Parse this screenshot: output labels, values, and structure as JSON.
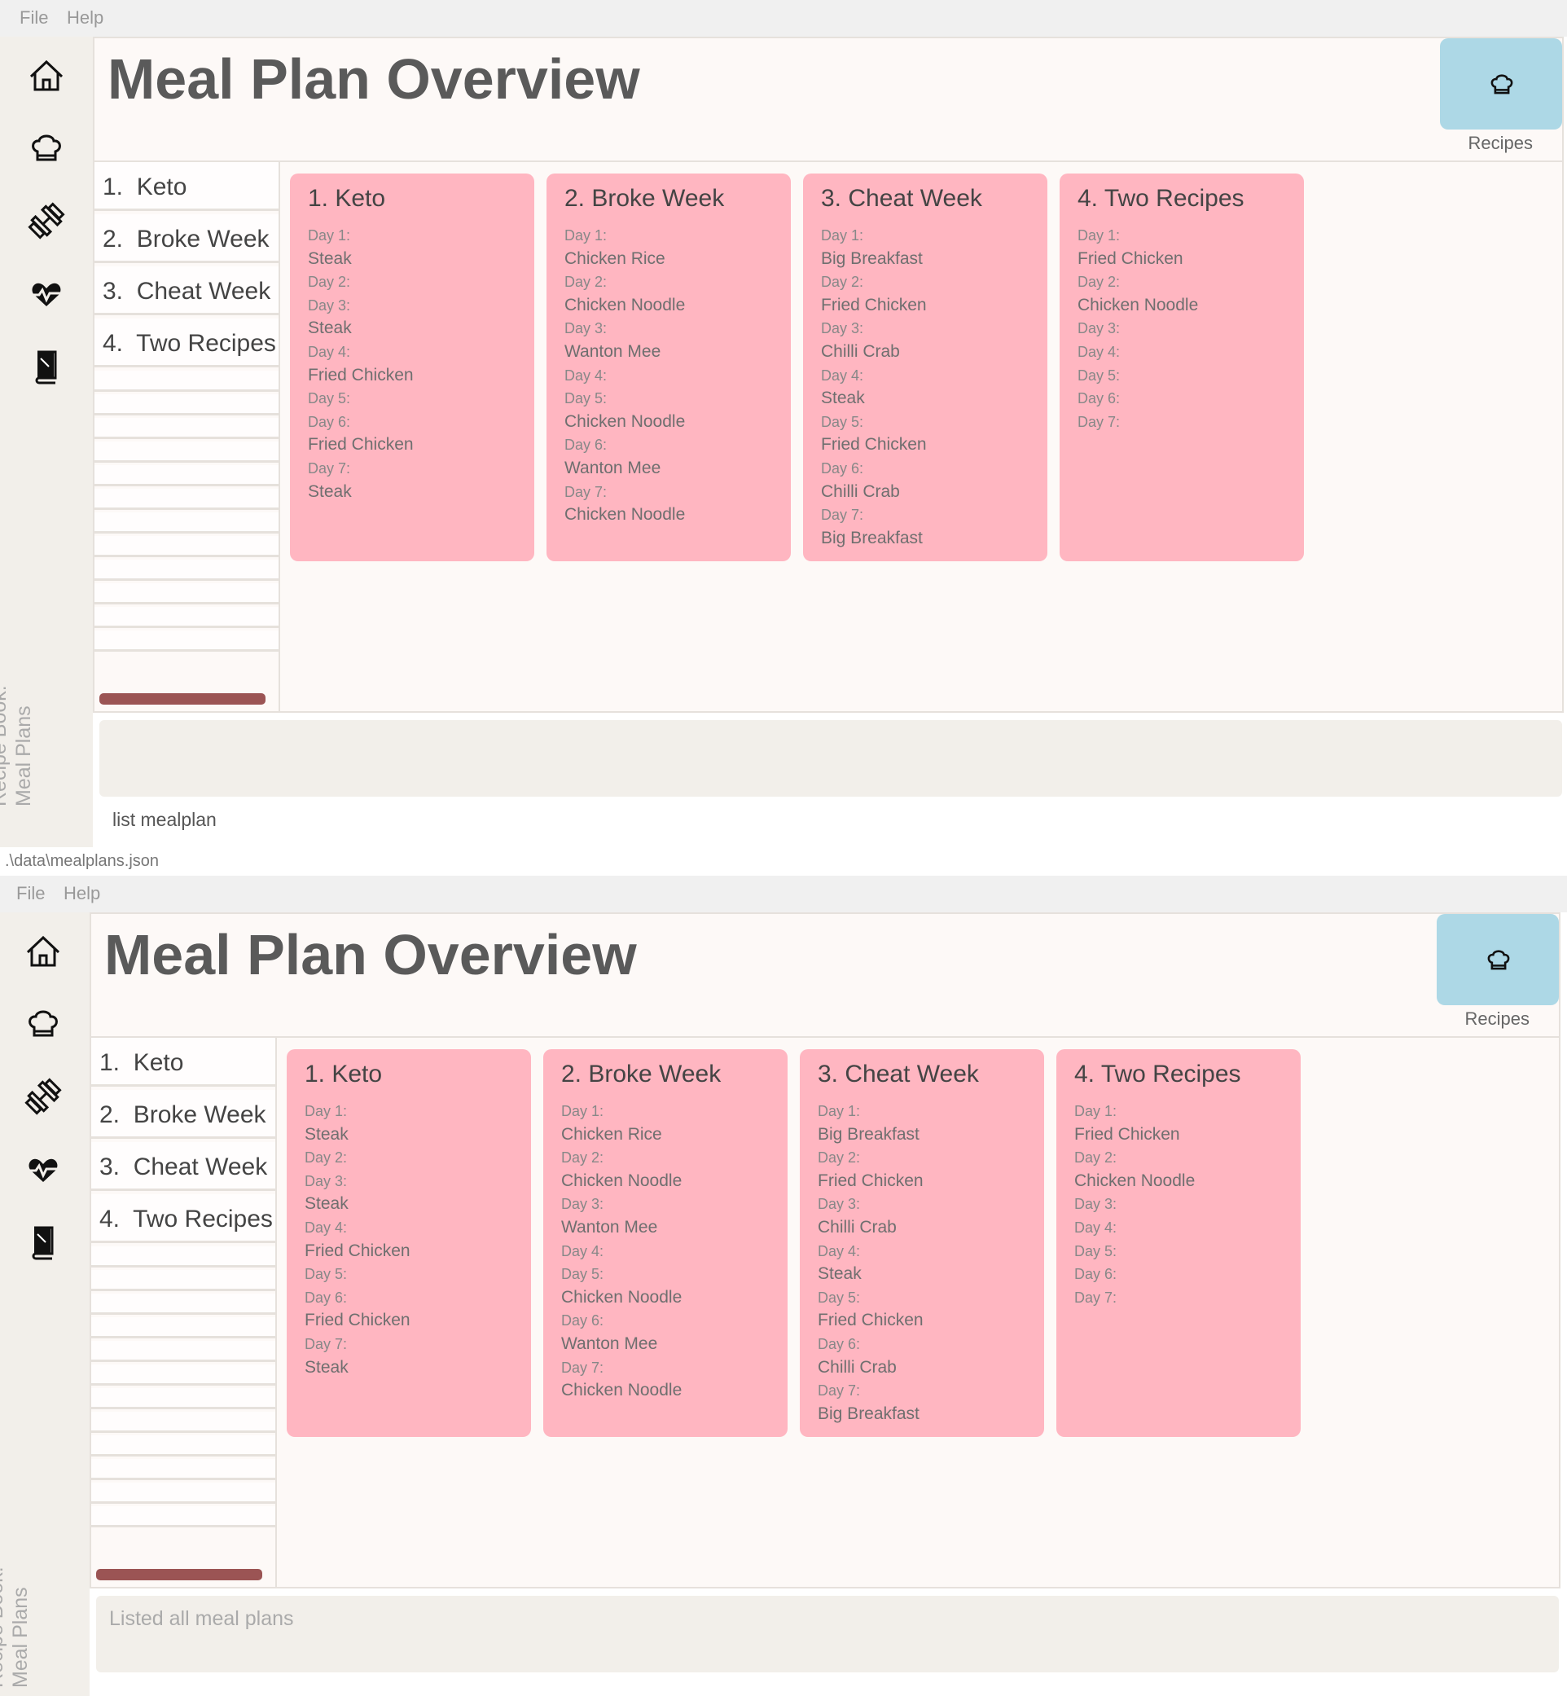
{
  "menu": {
    "file": "File",
    "help": "Help"
  },
  "sidebar": {
    "title_line1": "Recipe Book:",
    "title_line2": "Meal Plans",
    "icons": [
      "home-icon",
      "chef-hat-icon",
      "dumbbell-icon",
      "heartbeat-icon",
      "book-icon"
    ]
  },
  "page_title": "Meal Plan Overview",
  "recipes_button": {
    "label": "Recipes",
    "icon": "chef-hat-icon"
  },
  "plan_list": [
    {
      "index": "1.",
      "name": "Keto"
    },
    {
      "index": "2.",
      "name": "Broke Week"
    },
    {
      "index": "3.",
      "name": "Cheat Week"
    },
    {
      "index": "4.",
      "name": "Two Recipes"
    }
  ],
  "cards": [
    {
      "title": "1.  Keto",
      "lines": [
        "Day 1:",
        "Steak",
        "Day 2:",
        "Day 3:",
        "Steak",
        "Day 4:",
        "Fried Chicken",
        "Day 5:",
        "Day 6:",
        "Fried Chicken",
        "Day 7:",
        "Steak"
      ]
    },
    {
      "title": "2.  Broke Week",
      "lines": [
        "Day 1:",
        "Chicken Rice",
        "Day 2:",
        "Chicken Noodle",
        "Day 3:",
        "Wanton Mee",
        "Day 4:",
        "Day 5:",
        "Chicken Noodle",
        "Day 6:",
        "Wanton Mee",
        "Day 7:",
        "Chicken Noodle"
      ]
    },
    {
      "title": "3.  Cheat Week",
      "lines": [
        "Day 1:",
        "Big Breakfast",
        "Day 2:",
        "Fried Chicken",
        "Day 3:",
        "Chilli Crab",
        "Day 4:",
        "Steak",
        "Day 5:",
        "Fried Chicken",
        "Day 6:",
        "Chilli Crab",
        "Day 7:",
        "Big Breakfast"
      ]
    },
    {
      "title": "4.  Two Recipes",
      "lines": [
        "Day 1:",
        "Fried Chicken",
        "Day 2:",
        "Chicken Noodle",
        "Day 3:",
        "Day 4:",
        "Day 5:",
        "Day 6:",
        "Day 7:"
      ]
    }
  ],
  "command_input": {
    "value": "list mealplan"
  },
  "result_display": {
    "text": "Listed all meal plans"
  },
  "status_bar": {
    "path": ".\\data\\mealplans.json"
  },
  "colors": {
    "card": "#ffb6c1",
    "recipes_button": "#add8e6",
    "scrollbar": "#9b5454",
    "background": "#fdf9f7"
  }
}
